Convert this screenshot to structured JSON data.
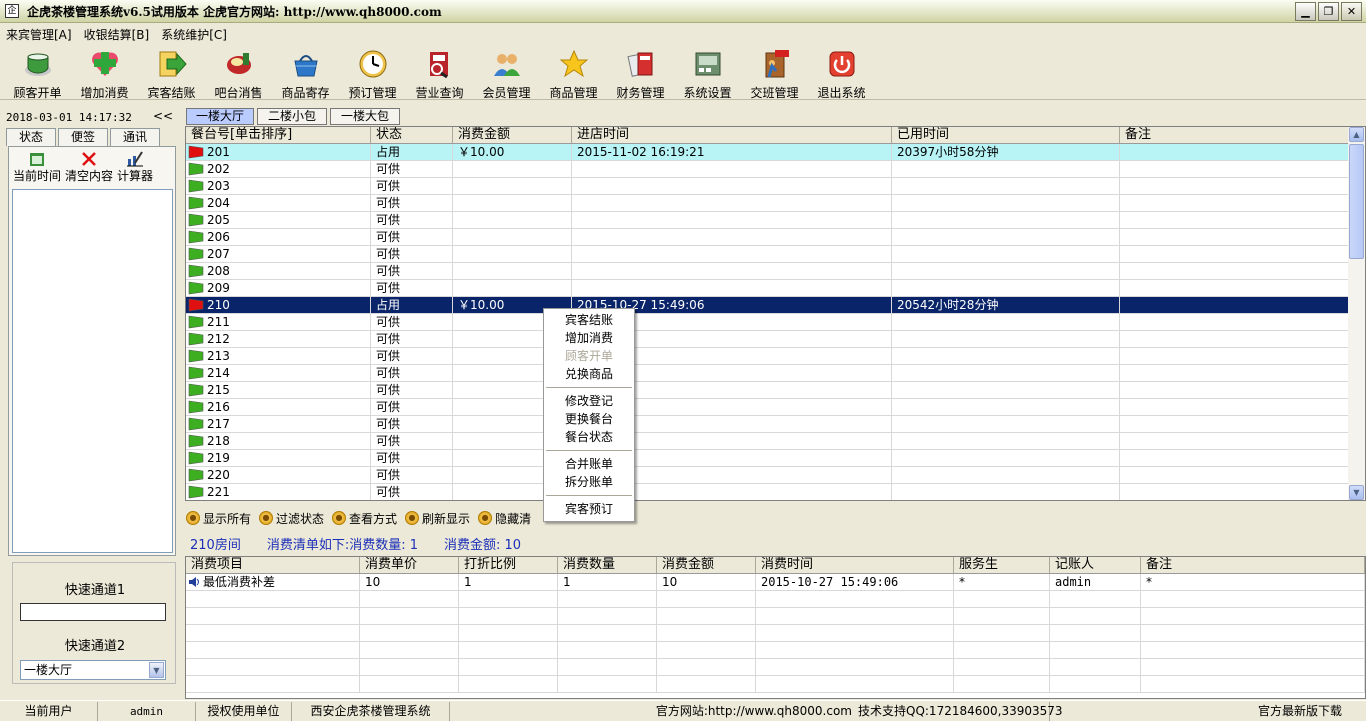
{
  "window": {
    "title": "企虎茶楼管理系统v6.5试用版本 企虎官方网站: http://www.qh8000.com",
    "icon": "app-window-icon",
    "buttons": [
      "minimize",
      "restore",
      "close"
    ]
  },
  "menu": [
    "来宾管理[A]",
    "收银结算[B]",
    "系统维护[C]"
  ],
  "toolbar": [
    {
      "label": "顾客开单",
      "icon": "teacup-icon"
    },
    {
      "label": "增加消费",
      "icon": "add-heart-icon"
    },
    {
      "label": "宾客结账",
      "icon": "checkout-arrow-icon"
    },
    {
      "label": "吧台消售",
      "icon": "bar-counter-icon"
    },
    {
      "label": "商品寄存",
      "icon": "basket-icon"
    },
    {
      "label": "预订管理",
      "icon": "clock-icon"
    },
    {
      "label": "营业查询",
      "icon": "search-report-icon"
    },
    {
      "label": "会员管理",
      "icon": "members-icon"
    },
    {
      "label": "商品管理",
      "icon": "star-icon"
    },
    {
      "label": "财务管理",
      "icon": "calculator-icon"
    },
    {
      "label": "系统设置",
      "icon": "settings-icon"
    },
    {
      "label": "交班管理",
      "icon": "exit-door-icon"
    },
    {
      "label": "退出系统",
      "icon": "power-icon"
    }
  ],
  "left": {
    "datetime": "2018-03-01 14:17:32",
    "collapse": "<<",
    "tabs": [
      "状态",
      "便签",
      "通讯"
    ],
    "buttons": [
      "当前时间",
      "清空内容",
      "计算器"
    ],
    "quick1_label": "快速通道1",
    "quick2_label": "快速通道2",
    "quick2_value": "一楼大厅"
  },
  "room_tabs": [
    "一楼大厅",
    "二楼小包",
    "一楼大包"
  ],
  "table": {
    "columns": [
      "餐台号[单击排序]",
      "状态",
      "消费金额",
      "进店时间",
      "已用时间",
      "备注"
    ],
    "rows": [
      [
        "201",
        "占用",
        "￥10.00",
        "2015-11-02 16:19:21",
        "20397小时58分钟",
        ""
      ],
      [
        "202",
        "可供",
        "",
        "",
        "",
        ""
      ],
      [
        "203",
        "可供",
        "",
        "",
        "",
        ""
      ],
      [
        "204",
        "可供",
        "",
        "",
        "",
        ""
      ],
      [
        "205",
        "可供",
        "",
        "",
        "",
        ""
      ],
      [
        "206",
        "可供",
        "",
        "",
        "",
        ""
      ],
      [
        "207",
        "可供",
        "",
        "",
        "",
        ""
      ],
      [
        "208",
        "可供",
        "",
        "",
        "",
        ""
      ],
      [
        "209",
        "可供",
        "",
        "",
        "",
        ""
      ],
      [
        "210",
        "占用",
        "￥10.00",
        "2015-10-27 15:49:06",
        "20542小时28分钟",
        ""
      ],
      [
        "211",
        "可供",
        "",
        "",
        "",
        ""
      ],
      [
        "212",
        "可供",
        "",
        "",
        "",
        ""
      ],
      [
        "213",
        "可供",
        "",
        "",
        "",
        ""
      ],
      [
        "214",
        "可供",
        "",
        "",
        "",
        ""
      ],
      [
        "215",
        "可供",
        "",
        "",
        "",
        ""
      ],
      [
        "216",
        "可供",
        "",
        "",
        "",
        ""
      ],
      [
        "217",
        "可供",
        "",
        "",
        "",
        ""
      ],
      [
        "218",
        "可供",
        "",
        "",
        "",
        ""
      ],
      [
        "219",
        "可供",
        "",
        "",
        "",
        ""
      ],
      [
        "220",
        "可供",
        "",
        "",
        "",
        ""
      ],
      [
        "221",
        "可供",
        "",
        "",
        "",
        ""
      ]
    ]
  },
  "context_menu": {
    "groups": [
      [
        {
          "label": "宾客结账",
          "enabled": true
        },
        {
          "label": "增加消费",
          "enabled": true
        },
        {
          "label": "顾客开单",
          "enabled": false
        },
        {
          "label": "兑换商品",
          "enabled": true
        }
      ],
      [
        {
          "label": "修改登记",
          "enabled": true
        },
        {
          "label": "更换餐台",
          "enabled": true
        },
        {
          "label": "餐台状态",
          "enabled": true
        }
      ],
      [
        {
          "label": "合并账单",
          "enabled": true
        },
        {
          "label": "拆分账单",
          "enabled": true
        }
      ],
      [
        {
          "label": "宾客预订",
          "enabled": true
        }
      ]
    ]
  },
  "actions": [
    "显示所有",
    "过滤状态",
    "查看方式",
    "刷新显示",
    "隐藏清"
  ],
  "summary": {
    "room": "210房间",
    "items": "消费清单如下:消费数量: 1",
    "amount": "消费金额: 10"
  },
  "detail": {
    "columns": [
      "消费项目",
      "消费单价",
      "打折比例",
      "消费数量",
      "消费金额",
      "消费时间",
      "服务生",
      "记账人",
      "备注"
    ],
    "rows": [
      [
        "最低消费补差",
        "10",
        "1",
        "1",
        "10",
        "2015-10-27 15:49:06",
        "*",
        "admin",
        "*"
      ]
    ]
  },
  "status": {
    "user_label": "当前用户",
    "user": "admin",
    "auth_label": "授权使用单位",
    "auth": "西安企虎茶楼管理系统",
    "site": "官方网站:http://www.qh8000.com",
    "support": "技术支持QQ:172184600,33903573",
    "download": "官方最新版下载"
  },
  "colors": {
    "selected_row": "#0a246a",
    "occupied_row": "#b8f4f6",
    "flag_free": "#3cae20",
    "flag_busy": "#e01010",
    "summary_text": "#1b2fb8"
  }
}
